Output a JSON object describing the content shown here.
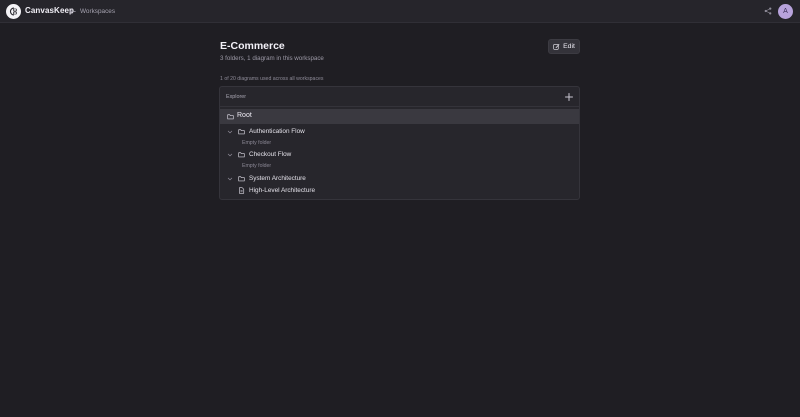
{
  "app": {
    "brand": "CanvasKeep",
    "back_label": "Workspaces",
    "avatar_initial": "A"
  },
  "workspace": {
    "title": "E-Commerce",
    "subtitle": "3 folders, 1 diagram in this workspace",
    "edit_label": "Edit",
    "usage": "1 of 20 diagrams used across all workspaces"
  },
  "explorer": {
    "header": "Explorer",
    "root_label": "Root",
    "items": [
      {
        "label": "Authentication Flow",
        "type": "folder",
        "empty_text": "Empty folder"
      },
      {
        "label": "Checkout Flow",
        "type": "folder",
        "empty_text": "Empty folder"
      },
      {
        "label": "System Architecture",
        "type": "folder"
      },
      {
        "label": "High-Level Architecture",
        "type": "diagram"
      }
    ]
  },
  "colors": {
    "background": "#1f1e23",
    "panel": "#27262c",
    "selected_row": "#3a3940",
    "avatar": "#b8a3dc"
  }
}
